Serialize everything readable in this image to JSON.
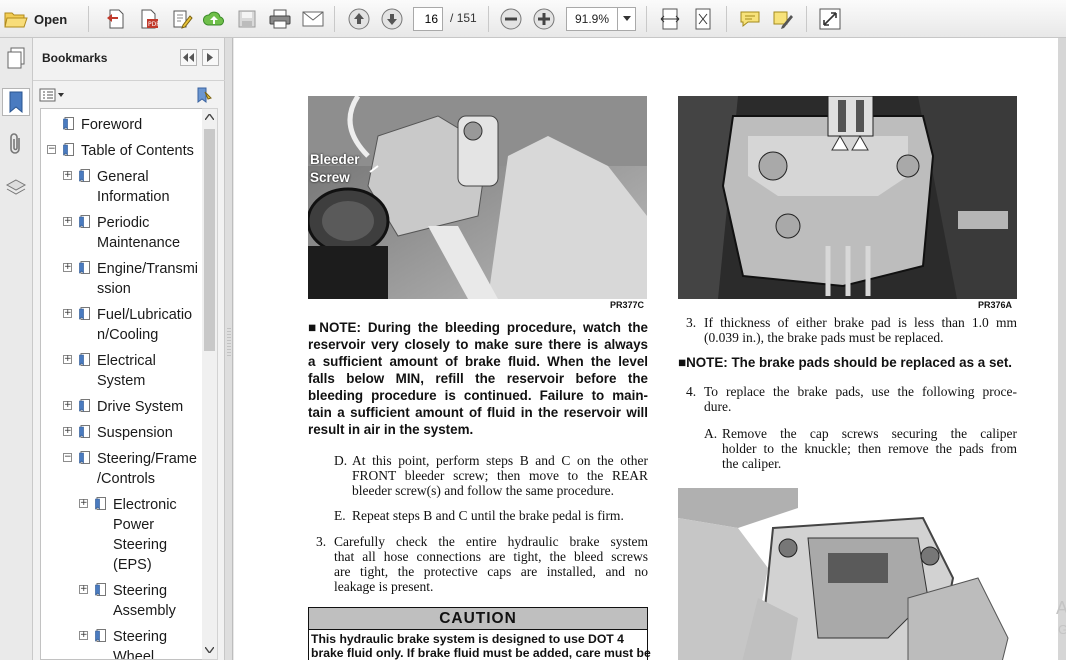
{
  "toolbar": {
    "open_label": "Open",
    "page_current": "16",
    "page_separator": "/",
    "page_total": "151",
    "zoom": "91.9%"
  },
  "panel": {
    "title": "Bookmarks"
  },
  "bookmarks": [
    {
      "label": "Foreword",
      "lines": [
        "Foreword"
      ]
    },
    {
      "label": "Table of Contents",
      "lines": [
        "Table of Contents"
      ]
    },
    {
      "label": "General Information",
      "lines": [
        "General",
        "Information"
      ]
    },
    {
      "label": "Periodic Maintenance",
      "lines": [
        "Periodic",
        "Maintenance"
      ]
    },
    {
      "label": "Engine/Transmission",
      "lines": [
        "Engine/Transmi",
        "ssion"
      ]
    },
    {
      "label": "Fuel/Lubrication/Cooling",
      "lines": [
        "Fuel/Lubricatio",
        "n/Cooling"
      ]
    },
    {
      "label": "Electrical System",
      "lines": [
        "Electrical",
        "System"
      ]
    },
    {
      "label": "Drive System",
      "lines": [
        "Drive System"
      ]
    },
    {
      "label": "Suspension",
      "lines": [
        "Suspension"
      ]
    },
    {
      "label": "Steering/Frame/Controls",
      "lines": [
        "Steering/Frame",
        "/Controls"
      ]
    },
    {
      "label": "Electronic Power Steering (EPS)",
      "lines": [
        "Electronic",
        "Power",
        "Steering",
        "(EPS)"
      ]
    },
    {
      "label": "Steering Assembly",
      "lines": [
        "Steering",
        "Assembly"
      ]
    },
    {
      "label": "Steering Wheel",
      "lines": [
        "Steering",
        "Wheel"
      ]
    }
  ],
  "document": {
    "left": {
      "photo_label_1": "Bleeder",
      "photo_label_2": "Screw",
      "photo_caption": "PR377C",
      "note_lines": [
        "■NOTE: During the bleeding procedure, watch the",
        "reservoir very closely to make sure there is always",
        "a sufficient amount of brake fluid. When the level",
        "falls below MIN, refill the reservoir before the",
        "bleeding procedure is continued. Failure to main-",
        "tain a sufficient amount of fluid in the reservoir will",
        "result in air in the system."
      ],
      "step_d_marker": "D.",
      "step_d_lines": [
        "At this point, perform steps B and C on the other",
        "FRONT bleeder screw; then move to the REAR",
        "bleeder screw(s) and follow the same procedure."
      ],
      "step_e_marker": "E.",
      "step_e_lines": [
        "Repeat steps B and C until the brake pedal is firm."
      ],
      "step_3_marker": "3.",
      "step_3_lines": [
        "Carefully check the entire hydraulic brake system",
        "that all hose connections are tight, the bleed screws",
        "are tight, the protective caps are installed, and no",
        "leakage is present."
      ],
      "caution_title": "CAUTION",
      "caution_lines": [
        "This hydraulic brake system is designed to use DOT 4",
        "brake fluid only. If brake fluid must be added, care must be"
      ]
    },
    "right": {
      "photo_caption": "PR376A",
      "step_3_marker": "3.",
      "step_3_lines": [
        "If thickness of either brake pad is less than 1.0 mm",
        "(0.039 in.), the brake pads must be replaced."
      ],
      "note_line": "■NOTE: The brake pads should be replaced as a set.",
      "step_4_marker": "4.",
      "step_4_lines": [
        "To replace the brake pads, use the following proce-",
        "dure."
      ],
      "step_a_marker": "A.",
      "step_a_lines": [
        "Remove the cap screws securing the caliper",
        "holder to the knuckle; then remove the pads from",
        "the caliper."
      ]
    },
    "edge_glyph_1": "A",
    "edge_glyph_2": "G"
  },
  "colors": {
    "toolbar_bg": "#eeeeee",
    "page_bg": "#ffffff",
    "icon_blue": "#3a6fb0",
    "icon_green": "#3b9a3b",
    "icon_yellow": "#e8c33a",
    "caution_band": "#bfbfbf"
  }
}
